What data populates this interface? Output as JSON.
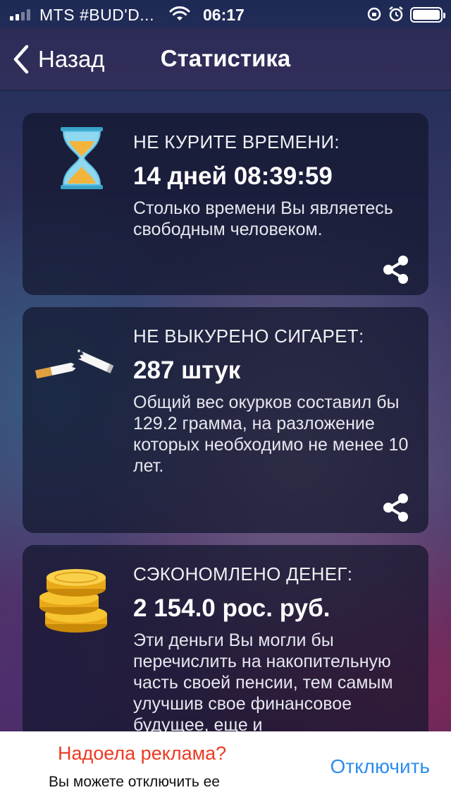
{
  "status_bar": {
    "carrier": "MTS #BUD'D...",
    "time": "06:17"
  },
  "nav": {
    "back_label": "Назад",
    "title": "Статистика"
  },
  "cards": [
    {
      "icon": "hourglass-icon",
      "label": "НЕ КУРИТЕ ВРЕМЕНИ:",
      "value": "14 дней 08:39:59",
      "description": "Столько времени Вы являетесь свободным человеком."
    },
    {
      "icon": "broken-cigarette-icon",
      "label": "НЕ ВЫКУРЕНО СИГАРЕТ:",
      "value": "287 штук",
      "description": "Общий вес окурков составил бы 129.2 грамма, на разложение которых необходимо не менее 10 лет."
    },
    {
      "icon": "coins-icon",
      "label": "СЭКОНОМЛЕНО ДЕНЕГ:",
      "value": "2 154.0 рос. руб.",
      "description": "Эти деньги Вы могли бы перечислить на накопительную часть своей пенсии, тем самым улучшив свое финансовое будущее, еще и"
    }
  ],
  "ad": {
    "title": "Надоела реклама?",
    "subtitle": "Вы можете отключить ее",
    "button": "Отключить"
  },
  "colors": {
    "ad_title": "#ec3a22",
    "ad_button": "#2c8df0"
  }
}
